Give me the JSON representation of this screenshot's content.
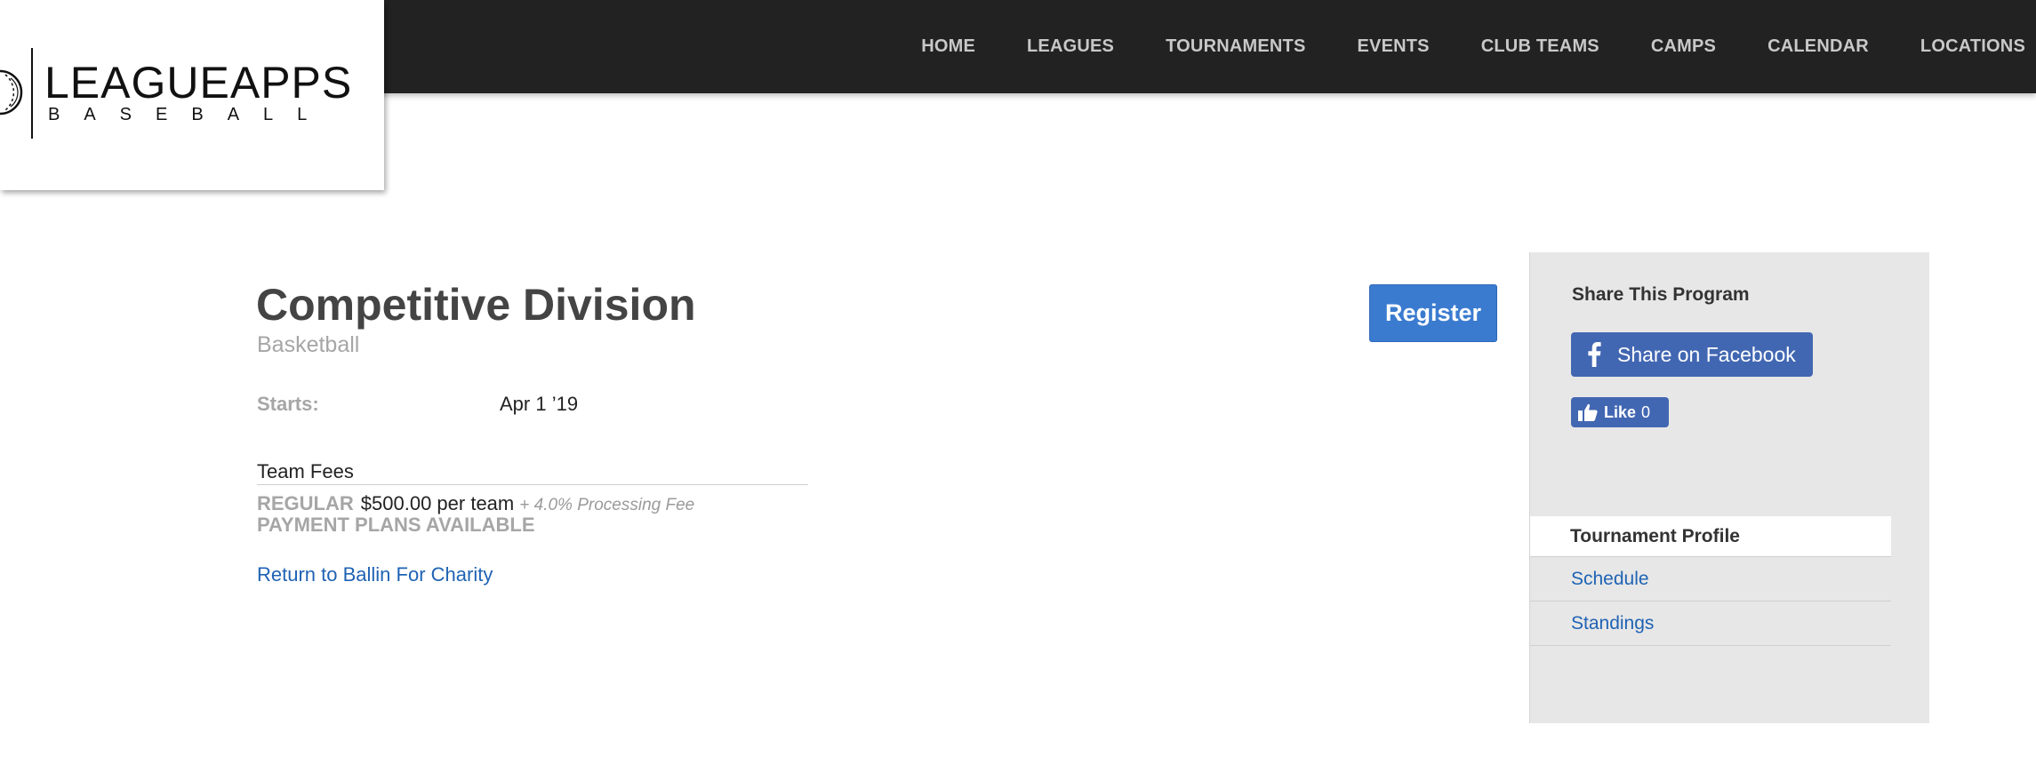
{
  "logo": {
    "title": "LEAGUEAPPS",
    "subtitle": "BASEBALL"
  },
  "nav": {
    "items": [
      {
        "label": "HOME"
      },
      {
        "label": "LEAGUES"
      },
      {
        "label": "TOURNAMENTS"
      },
      {
        "label": "EVENTS"
      },
      {
        "label": "CLUB TEAMS"
      },
      {
        "label": "CAMPS"
      },
      {
        "label": "CALENDAR"
      },
      {
        "label": "LOCATIONS"
      }
    ]
  },
  "program": {
    "title": "Competitive Division",
    "sport": "Basketball",
    "starts_label": "Starts:",
    "starts_value": "Apr 1 ’19",
    "fees_heading": "Team Fees",
    "fee": {
      "label": "REGULAR",
      "amount": "$500.00 per team",
      "processing": "+ 4.0% Processing Fee"
    },
    "payment_plans": "PAYMENT PLANS AVAILABLE",
    "return_link": "Return to Ballin For Charity",
    "register_label": "Register"
  },
  "sidebar": {
    "share_title": "Share This Program",
    "facebook_share_label": "Share on Facebook",
    "like_label": "Like",
    "like_count": "0",
    "nav": [
      {
        "label": "Tournament Profile",
        "active": true
      },
      {
        "label": "Schedule",
        "active": false
      },
      {
        "label": "Standings",
        "active": false
      }
    ]
  },
  "colors": {
    "topbar": "#222222",
    "link": "#1f63b4",
    "register": "#3a7bd0",
    "facebook": "#4267b2",
    "sidebar_bg": "#e7e7e7"
  },
  "icons": {
    "logo_mark": "baseball-icon",
    "facebook": "facebook-icon",
    "like": "thumbs-up-icon"
  }
}
